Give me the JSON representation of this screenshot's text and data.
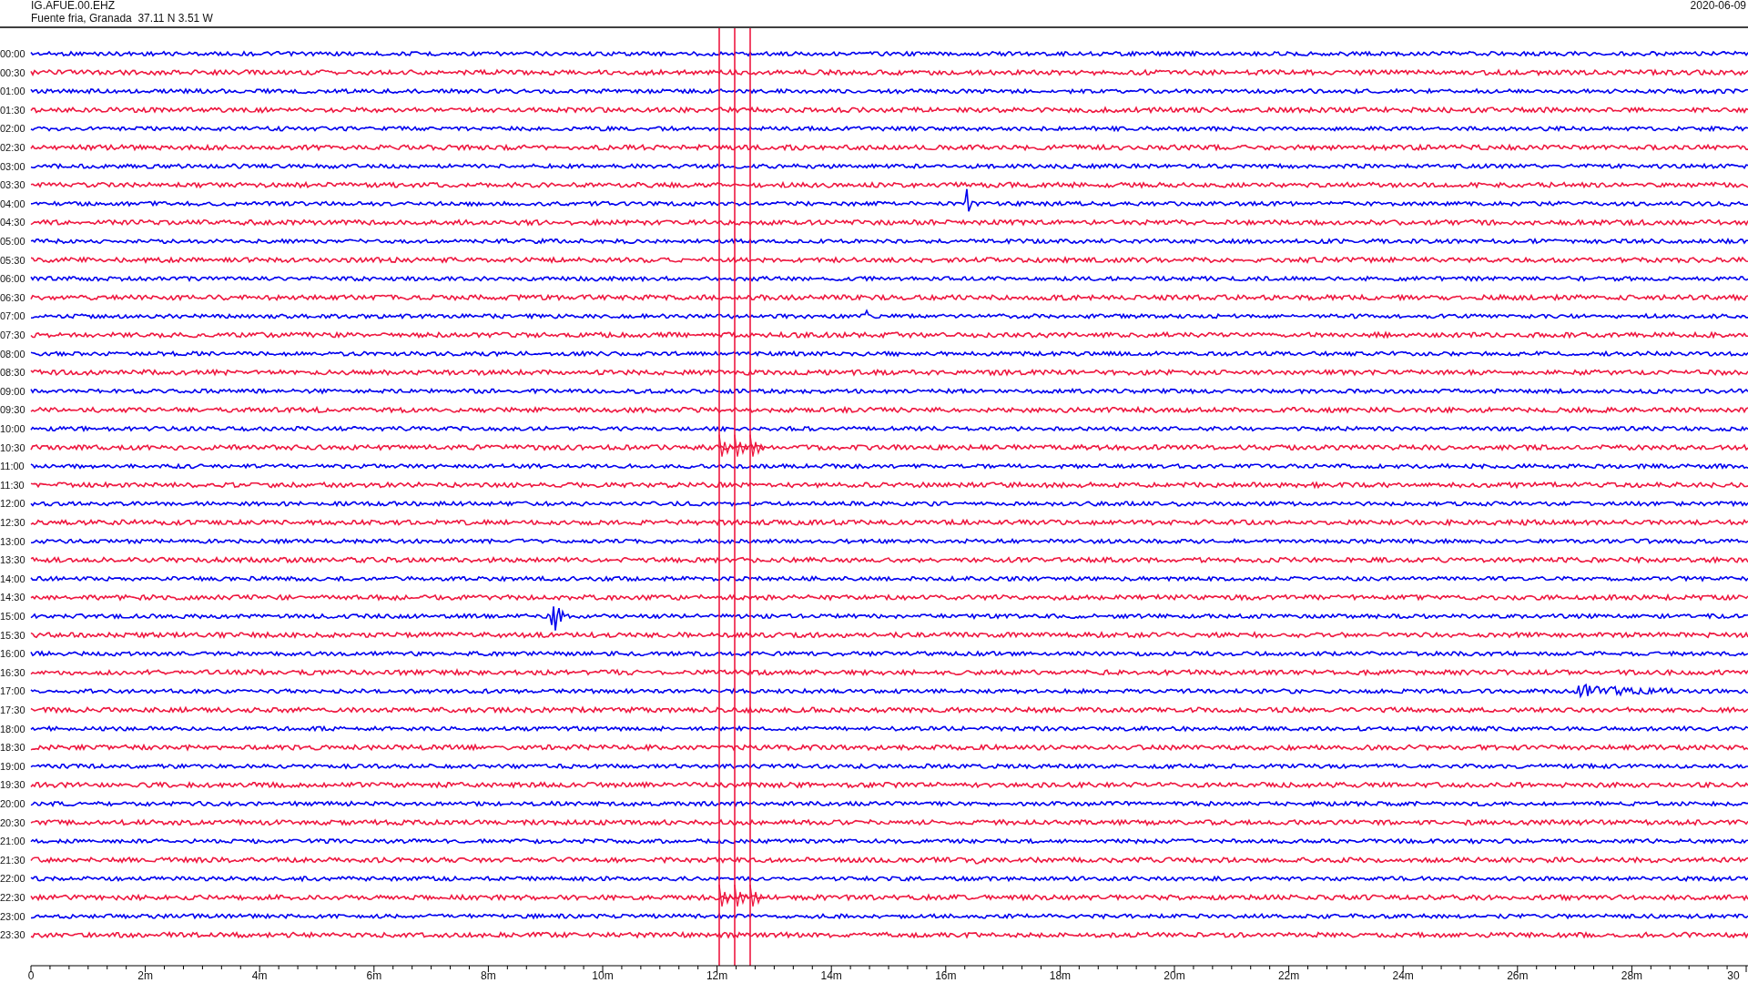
{
  "header": {
    "station": "IG.AFUE.00.EHZ",
    "location": "Fuente fria, Granada  37.11 N 3.51 W",
    "date": "2020-06-09"
  },
  "traces": [
    {
      "label": "00:00",
      "color": "#0000ee"
    },
    {
      "label": "00:30",
      "color": "#ee1840"
    },
    {
      "label": "01:00",
      "color": "#0000ee"
    },
    {
      "label": "01:30",
      "color": "#ee1840"
    },
    {
      "label": "02:00",
      "color": "#0000ee"
    },
    {
      "label": "02:30",
      "color": "#ee1840"
    },
    {
      "label": "03:00",
      "color": "#0000ee"
    },
    {
      "label": "03:30",
      "color": "#ee1840"
    },
    {
      "label": "04:00",
      "color": "#0000ee"
    },
    {
      "label": "04:30",
      "color": "#ee1840"
    },
    {
      "label": "05:00",
      "color": "#0000ee"
    },
    {
      "label": "05:30",
      "color": "#ee1840"
    },
    {
      "label": "06:00",
      "color": "#0000ee"
    },
    {
      "label": "06:30",
      "color": "#ee1840"
    },
    {
      "label": "07:00",
      "color": "#0000ee"
    },
    {
      "label": "07:30",
      "color": "#ee1840"
    },
    {
      "label": "08:00",
      "color": "#0000ee"
    },
    {
      "label": "08:30",
      "color": "#ee1840"
    },
    {
      "label": "09:00",
      "color": "#0000ee"
    },
    {
      "label": "09:30",
      "color": "#ee1840"
    },
    {
      "label": "10:00",
      "color": "#0000ee"
    },
    {
      "label": "10:30",
      "color": "#ee1840"
    },
    {
      "label": "11:00",
      "color": "#0000ee"
    },
    {
      "label": "11:30",
      "color": "#ee1840"
    },
    {
      "label": "12:00",
      "color": "#0000ee"
    },
    {
      "label": "12:30",
      "color": "#ee1840"
    },
    {
      "label": "13:00",
      "color": "#0000ee"
    },
    {
      "label": "13:30",
      "color": "#ee1840"
    },
    {
      "label": "14:00",
      "color": "#0000ee"
    },
    {
      "label": "14:30",
      "color": "#ee1840"
    },
    {
      "label": "15:00",
      "color": "#0000ee"
    },
    {
      "label": "15:30",
      "color": "#ee1840"
    },
    {
      "label": "16:00",
      "color": "#0000ee"
    },
    {
      "label": "16:30",
      "color": "#ee1840"
    },
    {
      "label": "17:00",
      "color": "#0000ee"
    },
    {
      "label": "17:30",
      "color": "#ee1840"
    },
    {
      "label": "18:00",
      "color": "#0000ee"
    },
    {
      "label": "18:30",
      "color": "#ee1840"
    },
    {
      "label": "19:00",
      "color": "#0000ee"
    },
    {
      "label": "19:30",
      "color": "#ee1840"
    },
    {
      "label": "20:00",
      "color": "#0000ee"
    },
    {
      "label": "20:30",
      "color": "#ee1840"
    },
    {
      "label": "21:00",
      "color": "#0000ee"
    },
    {
      "label": "21:30",
      "color": "#ee1840"
    },
    {
      "label": "22:00",
      "color": "#0000ee"
    },
    {
      "label": "22:30",
      "color": "#ee1840"
    },
    {
      "label": "23:00",
      "color": "#0000ee"
    },
    {
      "label": "23:30",
      "color": "#ee1840"
    }
  ],
  "x_axis": {
    "ticks": [
      "0",
      "2m",
      "4m",
      "6m",
      "8m",
      "10m",
      "12m",
      "14m",
      "16m",
      "18m",
      "20m",
      "22m",
      "24m",
      "26m",
      "28m",
      "30"
    ]
  }
}
